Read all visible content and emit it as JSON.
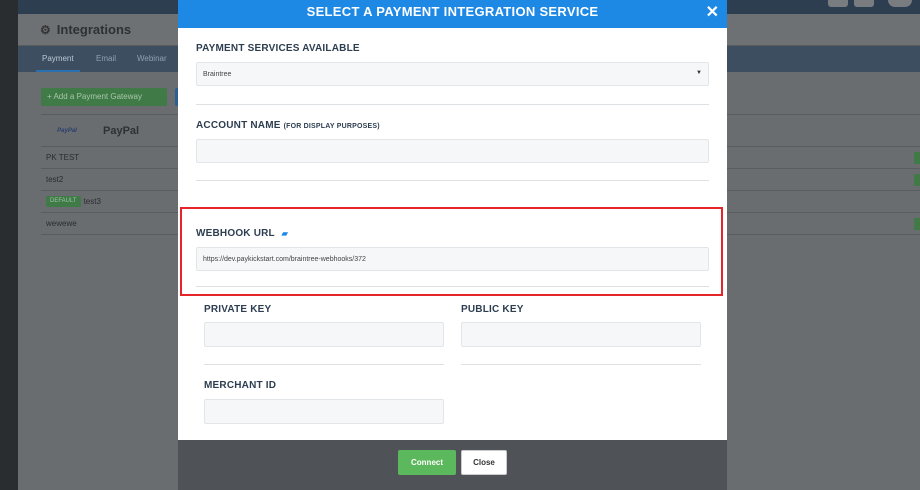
{
  "app": {
    "title": "Integrations",
    "tabs": [
      "Payment",
      "Email",
      "Webinar"
    ],
    "add_button": "+  Add a Payment Gateway",
    "gateway": {
      "logo": "PayPal",
      "name": "PayPal"
    },
    "rows": [
      {
        "tag": "",
        "name": "PK TEST"
      },
      {
        "tag": "",
        "name": "test2"
      },
      {
        "tag": "DEFAULT",
        "name": "test3"
      },
      {
        "tag": "",
        "name": "wewewe"
      }
    ]
  },
  "modal": {
    "title": "SELECT A PAYMENT INTEGRATION SERVICE",
    "close_symbol": "✕",
    "services_label": "PAYMENT SERVICES AVAILABLE",
    "service_selected": "Braintree",
    "account_label": "ACCOUNT NAME",
    "account_sublabel": "(FOR DISPLAY PURPOSES)",
    "account_value": "",
    "webhook_label": "WEBHOOK URL",
    "webhook_value": "https://dev.paykickstart.com/braintree-webhooks/372",
    "private_key_label": "PRIVATE KEY",
    "public_key_label": "PUBLIC KEY",
    "merchant_id_label": "MERCHANT ID",
    "connect_label": "Connect",
    "close_label": "Close"
  },
  "colors": {
    "header_blue": "#1e88e5",
    "connect_green": "#5cb85c",
    "highlight_red": "#e5252a"
  }
}
